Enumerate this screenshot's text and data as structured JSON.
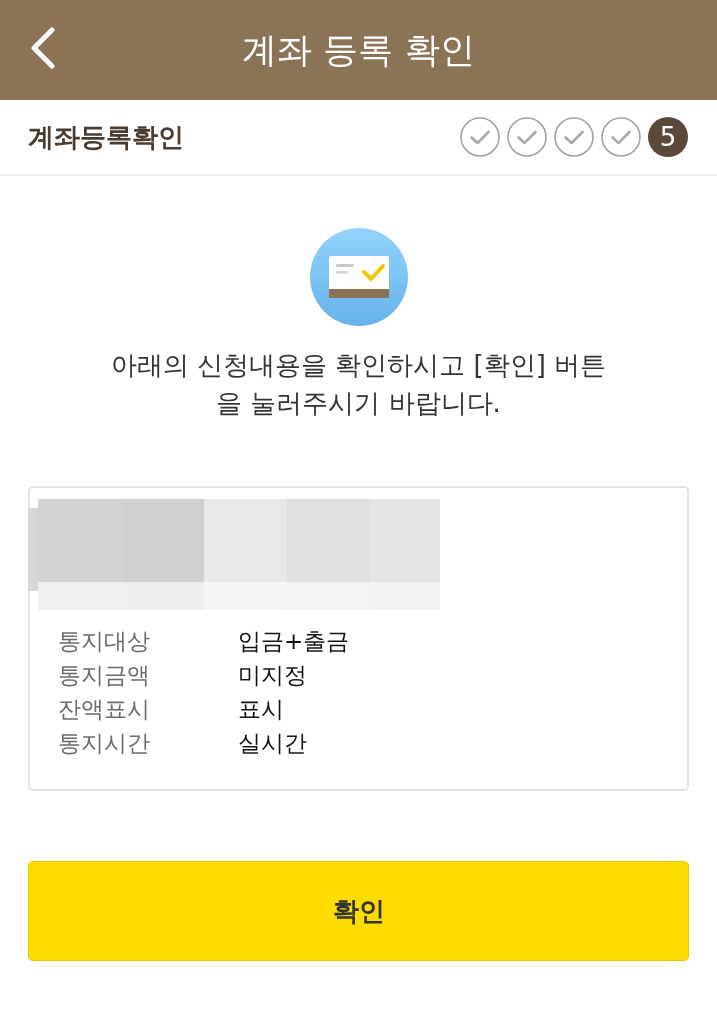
{
  "header": {
    "title": "계좌 등록 확인"
  },
  "subheader": {
    "title": "계좌등록확인",
    "steps": [
      {
        "kind": "done"
      },
      {
        "kind": "done"
      },
      {
        "kind": "done"
      },
      {
        "kind": "done"
      },
      {
        "kind": "current",
        "label": "5"
      }
    ]
  },
  "message": "아래의 신청내용을 확인하시고 [확인] 버튼 을 눌러주시기 바랍니다.",
  "details": [
    {
      "label": "통지대상",
      "value": "입금+출금"
    },
    {
      "label": "통지금액",
      "value": "미지정"
    },
    {
      "label": "잔액표시",
      "value": "표시"
    },
    {
      "label": "통지시간",
      "value": "실시간"
    }
  ],
  "confirm_button": "확인"
}
